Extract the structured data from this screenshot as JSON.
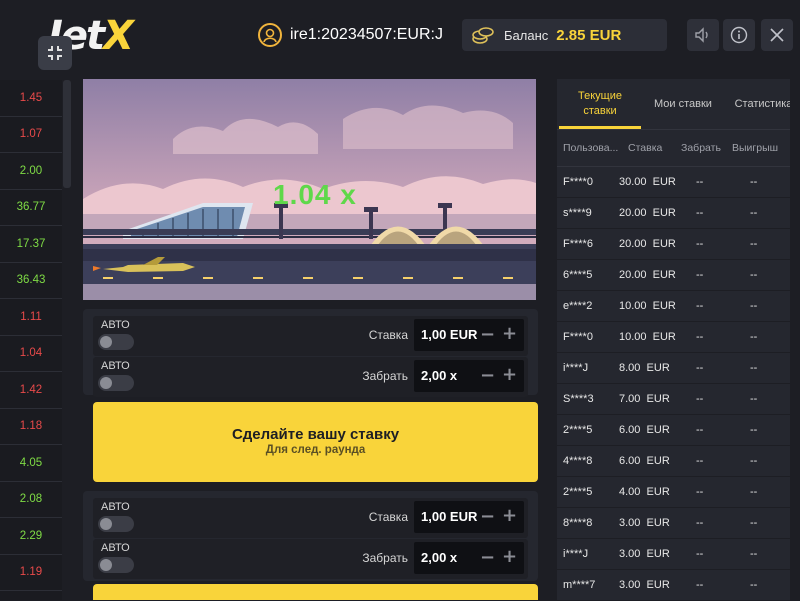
{
  "header": {
    "logo_part1": "Jet",
    "logo_part2": "X",
    "username": "ire1:20234507:EUR:J",
    "balance_label": "Баланс",
    "balance_value": "2.85 EUR",
    "icons": [
      "fullscreen-icon",
      "user-icon",
      "coins-icon",
      "sound-icon",
      "info-icon",
      "close-icon"
    ]
  },
  "history": [
    {
      "value": "1.45",
      "color": "#e84a4a"
    },
    {
      "value": "1.07",
      "color": "#e84a4a"
    },
    {
      "value": "2.00",
      "color": "#7fdc45"
    },
    {
      "value": "36.77",
      "color": "#7fdc45"
    },
    {
      "value": "17.37",
      "color": "#7fdc45"
    },
    {
      "value": "36.43",
      "color": "#7fdc45"
    },
    {
      "value": "1.11",
      "color": "#e84a4a"
    },
    {
      "value": "1.04",
      "color": "#e84a4a"
    },
    {
      "value": "1.42",
      "color": "#e84a4a"
    },
    {
      "value": "1.18",
      "color": "#e84a4a"
    },
    {
      "value": "4.05",
      "color": "#7fdc45"
    },
    {
      "value": "2.08",
      "color": "#7fdc45"
    },
    {
      "value": "2.29",
      "color": "#7fdc45"
    },
    {
      "value": "1.19",
      "color": "#e84a4a"
    }
  ],
  "game": {
    "multiplier": "1.04 x"
  },
  "bet_panels": [
    {
      "auto1": "АВТО",
      "stake_label": "Ставка",
      "stake_value": "1,00 EUR",
      "auto2": "АВТО",
      "cashout_label": "Забрать",
      "cashout_value": "2,00 x",
      "button_main": "Сделайте вашу ставку",
      "button_sub": "Для след. раунда"
    },
    {
      "auto1": "АВТО",
      "stake_label": "Ставка",
      "stake_value": "1,00 EUR",
      "auto2": "АВТО",
      "cashout_label": "Забрать",
      "cashout_value": "2,00 x"
    }
  ],
  "sidebar": {
    "tabs": [
      {
        "label": "Текущие ставки",
        "active": true
      },
      {
        "label": "Мои ставки",
        "active": false
      },
      {
        "label": "Статистика",
        "active": false
      }
    ],
    "columns": [
      "Пользова...",
      "Ставка",
      "Забрать",
      "Выигрыш"
    ],
    "bets": [
      {
        "user": "F****0",
        "amount": "30.00",
        "currency": "EUR",
        "cashout": "--",
        "win": "--"
      },
      {
        "user": "s****9",
        "amount": "20.00",
        "currency": "EUR",
        "cashout": "--",
        "win": "--"
      },
      {
        "user": "F****6",
        "amount": "20.00",
        "currency": "EUR",
        "cashout": "--",
        "win": "--"
      },
      {
        "user": "6****5",
        "amount": "20.00",
        "currency": "EUR",
        "cashout": "--",
        "win": "--"
      },
      {
        "user": "e****2",
        "amount": "10.00",
        "currency": "EUR",
        "cashout": "--",
        "win": "--"
      },
      {
        "user": "F****0",
        "amount": "10.00",
        "currency": "EUR",
        "cashout": "--",
        "win": "--"
      },
      {
        "user": "i****J",
        "amount": "8.00",
        "currency": "EUR",
        "cashout": "--",
        "win": "--"
      },
      {
        "user": "S****3",
        "amount": "7.00",
        "currency": "EUR",
        "cashout": "--",
        "win": "--"
      },
      {
        "user": "2****5",
        "amount": "6.00",
        "currency": "EUR",
        "cashout": "--",
        "win": "--"
      },
      {
        "user": "4****8",
        "amount": "6.00",
        "currency": "EUR",
        "cashout": "--",
        "win": "--"
      },
      {
        "user": "2****5",
        "amount": "4.00",
        "currency": "EUR",
        "cashout": "--",
        "win": "--"
      },
      {
        "user": "8****8",
        "amount": "3.00",
        "currency": "EUR",
        "cashout": "--",
        "win": "--"
      },
      {
        "user": "i****J",
        "amount": "3.00",
        "currency": "EUR",
        "cashout": "--",
        "win": "--"
      },
      {
        "user": "m****7",
        "amount": "3.00",
        "currency": "EUR",
        "cashout": "--",
        "win": "--"
      }
    ]
  },
  "colors": {
    "accent": "#f9d43a",
    "multiplier": "#5fd84a",
    "win": "#7fdc45",
    "loss": "#e84a4a"
  }
}
